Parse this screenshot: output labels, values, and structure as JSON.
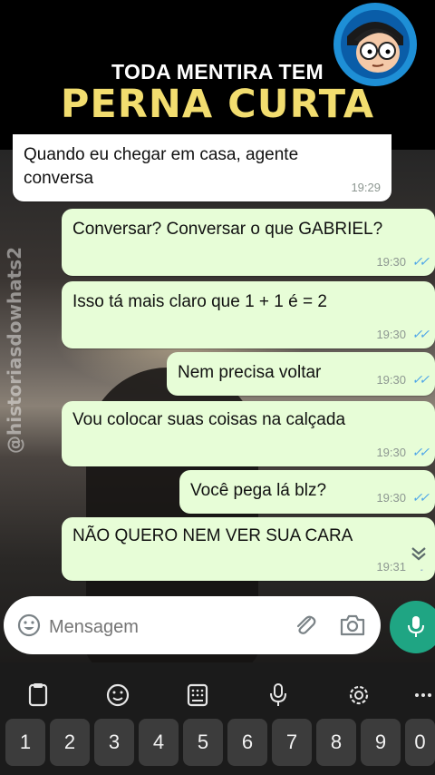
{
  "banner": {
    "line1": "TODA MENTIRA TEM",
    "line2": "PERNA CURTA",
    "title_color": "#f2dd6f"
  },
  "watermark": "@historiasdowhats2",
  "messages": [
    {
      "text": "Quando eu chegar em casa, agente conversa",
      "line1": "Quando eu chegar em casa, agente",
      "line2": "conversa",
      "time": "19:29",
      "direction": "incoming"
    },
    {
      "text": "Conversar? Conversar o que GABRIEL?",
      "time": "19:30",
      "direction": "outgoing",
      "status": "read"
    },
    {
      "text": "Isso tá mais claro que 1 + 1 é = 2",
      "time": "19:30",
      "direction": "outgoing",
      "status": "read"
    },
    {
      "text": "Nem precisa voltar",
      "time": "19:30",
      "direction": "outgoing",
      "status": "read"
    },
    {
      "text": "Vou colocar suas coisas na calçada",
      "time": "19:30",
      "direction": "outgoing",
      "status": "read"
    },
    {
      "text": "Você pega lá blz?",
      "time": "19:30",
      "direction": "outgoing",
      "status": "read"
    },
    {
      "text": "NÃO QUERO NEM VER SUA CARA",
      "time": "19:31",
      "direction": "outgoing",
      "status": "read"
    }
  ],
  "input": {
    "placeholder": "Mensagem"
  },
  "icons": {
    "emoji": "emoji-icon",
    "attach": "paperclip-icon",
    "camera": "camera-icon",
    "mic": "mic-icon",
    "scroll": "double-chevron-down-icon",
    "read_receipt": "double-check-icon"
  },
  "keyboard": {
    "toolbar": [
      "clipboard-icon",
      "emoji-icon",
      "keypad-icon",
      "mic-icon",
      "settings-icon",
      "more-icon"
    ],
    "number_row": [
      "1",
      "2",
      "3",
      "4",
      "5",
      "6",
      "7",
      "8",
      "9",
      "0"
    ]
  },
  "colors": {
    "outgoing_bubble": "#e7fdd7",
    "incoming_bubble": "#ffffff",
    "read_tick": "#4fa6e8",
    "mic_button": "#1fa583"
  }
}
